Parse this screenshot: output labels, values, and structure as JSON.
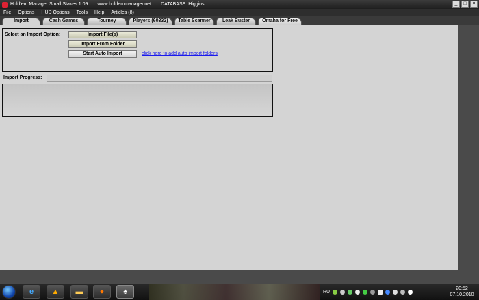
{
  "window": {
    "title": "Hold'em Manager Small Stakes 1.09",
    "website": "www.holdemmanager.net",
    "database": "DATABASE: Higgins"
  },
  "menu": [
    "File",
    "Options",
    "HUD Options",
    "Tools",
    "Help",
    "Articles (8)"
  ],
  "tabs": [
    {
      "label": "Import",
      "active": true
    },
    {
      "label": "Cash Games"
    },
    {
      "label": "Tourney"
    },
    {
      "label": "Players (60332)"
    },
    {
      "label": "Table Scanner"
    },
    {
      "label": "Leak Buster"
    },
    {
      "label": "Omaha for Free"
    }
  ],
  "import": {
    "label": "Select an Import Option:",
    "import_files": "Import File(s)",
    "import_folder": "Import From Folder",
    "auto_import": "Start Auto Import",
    "auto_folders_link": "click here to add auto import folders",
    "progress_label": "Import Progress:",
    "progress": 0
  },
  "taskbar": {
    "tray_lang": "RU",
    "time": "20:52",
    "date": "07.10.2010"
  },
  "icons": {
    "start": "windows-start-icon",
    "colors": {
      "link": "#1a1aee",
      "panel": "#d4d4d4",
      "chrome": "#2e2e2e"
    }
  }
}
